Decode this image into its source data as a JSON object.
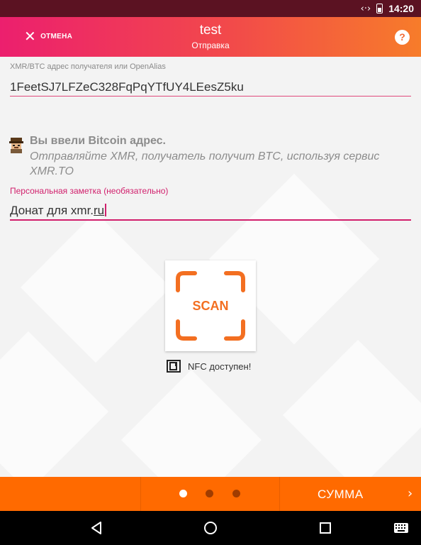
{
  "status_bar": {
    "time": "14:20"
  },
  "toolbar": {
    "cancel_label": "ОТМЕНА",
    "title": "test",
    "subtitle": "Отправка",
    "help_label": "?"
  },
  "address": {
    "label": "XMR/BTC адрес получателя или OpenAlias",
    "value": "1FeetSJ7LFZeC328FqPqYTfUY4LEesZ5ku"
  },
  "btc_notice": {
    "title": "Вы ввели Bitcoin адрес.",
    "description": "Отправляйте XMR, получатель получит BTC, используя сервис XMR.TO"
  },
  "note": {
    "label": "Персональная заметка (необязательно)",
    "value_prefix": "Донат для xmr.",
    "value_underlined": "ru"
  },
  "scan": {
    "label": "SCAN"
  },
  "nfc": {
    "label": "NFC доступен!"
  },
  "bottom_bar": {
    "pages": 3,
    "active_page": 1,
    "next_label": "СУММА"
  },
  "colors": {
    "accent": "#d11f6c",
    "orange": "#ff6a00",
    "scan_orange": "#f36f21"
  }
}
